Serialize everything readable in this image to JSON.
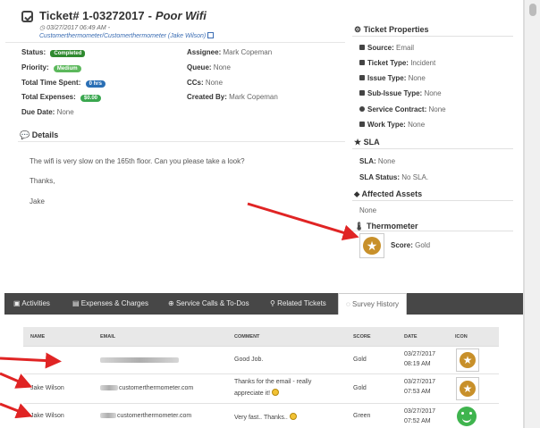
{
  "header": {
    "ticket_number": "Ticket# 1-03272017",
    "dash": "-",
    "subject": "Poor Wifi",
    "date": "03/27/2017 06:49 AM -",
    "account_link": "Customerthermometer/Customerthermometer (Jake Wilson)"
  },
  "fields": {
    "status_label": "Status:",
    "status_value": "Completed",
    "priority_label": "Priority:",
    "priority_value": "Medium",
    "time_label": "Total Time Spent:",
    "time_value": "0 hrs",
    "expenses_label": "Total Expenses:",
    "expenses_value": "$0.00",
    "due_label": "Due Date:",
    "due_value": "None",
    "assignee_label": "Assignee:",
    "assignee_value": "Mark Copeman",
    "queue_label": "Queue:",
    "queue_value": "None",
    "ccs_label": "CCs:",
    "ccs_value": "None",
    "created_label": "Created By:",
    "created_value": "Mark Copeman"
  },
  "details": {
    "title": "Details",
    "lines": [
      "The wifi is very slow on the 165th floor. Can you please take a look?",
      "Thanks,",
      "Jake"
    ]
  },
  "properties": {
    "title": "Ticket Properties",
    "source_label": "Source:",
    "source_value": "Email",
    "ticket_type_label": "Ticket Type:",
    "ticket_type_value": "Incident",
    "issue_type_label": "Issue Type:",
    "issue_type_value": "None",
    "sub_issue_label": "Sub-Issue Type:",
    "sub_issue_value": "None",
    "contract_label": "Service Contract:",
    "contract_value": "None",
    "work_type_label": "Work Type:",
    "work_type_value": "None"
  },
  "sla": {
    "title": "SLA",
    "sla_label": "SLA:",
    "sla_value": "None",
    "status_label": "SLA Status:",
    "status_value": "No SLA."
  },
  "assets": {
    "title": "Affected Assets",
    "value": "None"
  },
  "thermometer": {
    "title": "Thermometer",
    "score_label": "Score:",
    "score_value": "Gold"
  },
  "tabs": [
    {
      "label": "Activities",
      "icon": "comments-icon"
    },
    {
      "label": "Expenses & Charges",
      "icon": "money-icon"
    },
    {
      "label": "Service Calls & To-Dos",
      "icon": "lifebuoy-icon"
    },
    {
      "label": "Related Tickets",
      "icon": "link-icon"
    },
    {
      "label": "Survey History",
      "icon": "comment-icon"
    }
  ],
  "survey_table": {
    "headers": [
      "NAME",
      "EMAIL",
      "COMMENT",
      "SCORE",
      "DATE",
      "ICON"
    ],
    "rows": [
      {
        "name": "",
        "email": "",
        "comment": "Good Job.",
        "score": "Gold",
        "date": "03/27/2017",
        "time": "08:19 AM",
        "icon": "gold-medal-icon"
      },
      {
        "name": "Jake Wilson",
        "email": "customerthermometer.com",
        "comment_line1": "Thanks for the email - really",
        "comment_line2": "appreciate it!",
        "score": "Gold",
        "date": "03/27/2017",
        "time": "07:53 AM",
        "icon": "gold-medal-icon"
      },
      {
        "name": "Jake Wilson",
        "email": "customerthermometer.com",
        "comment": "Very fast.. Thanks..",
        "score": "Green",
        "date": "03/27/2017",
        "time": "07:52 AM",
        "icon": "green-smile-icon"
      }
    ]
  },
  "colors": {
    "completed": "#2f8a2f",
    "medium": "#5cb85c",
    "hours": "#2a6fb5",
    "expenses": "#3aa74f",
    "tabbar": "#474747",
    "arrow": "#e02424",
    "gold": "#c8902a"
  }
}
